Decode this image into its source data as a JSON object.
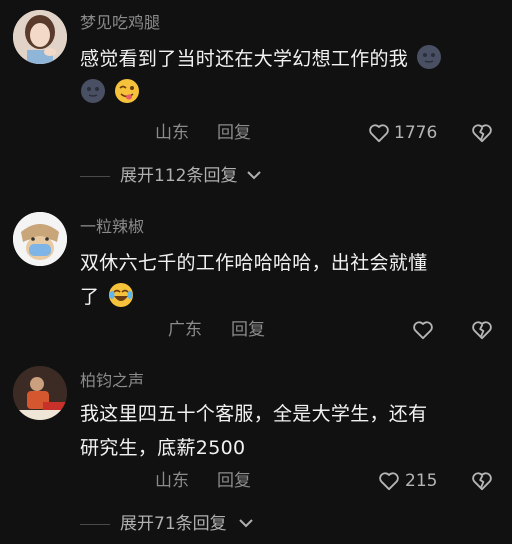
{
  "comments": [
    {
      "username": "梦见吃鸡腿",
      "text": "感觉看到了当时还在大学幻想工作的我",
      "location": "山东",
      "reply_label": "回复",
      "likes": "1776",
      "expand_label": "展开112条回复"
    },
    {
      "username": "一粒辣椒",
      "text_line1": "双休六七千的工作哈哈哈哈，出社会就懂",
      "text_line2": "了",
      "location": "广东",
      "reply_label": "回复"
    },
    {
      "username": "柏钧之声",
      "text_line1": "我这里四五十个客服，全是大学生，还有",
      "text_line2": "研究生，底薪2500",
      "location": "山东",
      "reply_label": "回复",
      "likes": "215",
      "expand_label": "展开71条回复"
    }
  ],
  "colors": {
    "background": "#111111",
    "muted_text": "#8b8b8b",
    "body_text": "#f2f2f2"
  },
  "icons": [
    "heart-icon",
    "dislike-heart-icon",
    "chevron-down-icon",
    "dark-moon-emoji",
    "wink-tongue-emoji",
    "laugh-cry-emoji"
  ]
}
